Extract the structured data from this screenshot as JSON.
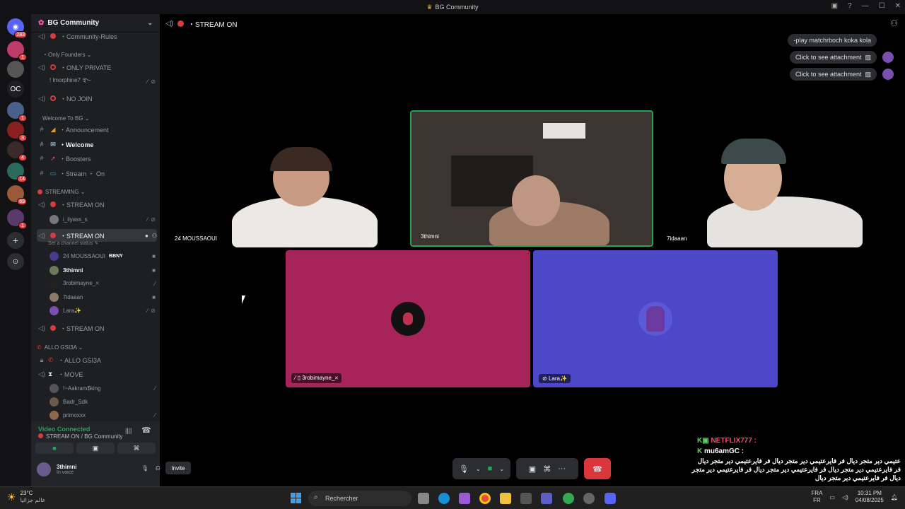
{
  "window": {
    "title": "BG Community",
    "title_icon": "trophy-icon"
  },
  "guilds": {
    "home_badge": "283",
    "items": [
      {
        "label": "",
        "badge": "1"
      },
      {
        "label": "",
        "badge": ""
      },
      {
        "label": "OC",
        "badge": ""
      },
      {
        "label": "",
        "badge": "1"
      },
      {
        "label": "",
        "badge": "3"
      },
      {
        "label": "",
        "badge": "4"
      },
      {
        "label": "",
        "badge": "14"
      },
      {
        "label": "",
        "badge": "69"
      },
      {
        "label": "",
        "badge": "1"
      }
    ]
  },
  "server": {
    "name": "BG Community",
    "channels": [
      {
        "type": "voice",
        "name": "・Community-Rules",
        "icon": "no-entry-icon"
      },
      {
        "type": "category",
        "name": "・Only Founders ⌄"
      },
      {
        "type": "voice",
        "name": "・ONLY PRIVATE",
        "icon": "no-entry-icon"
      },
      {
        "type": "voice",
        "name": "・NO JOIN",
        "icon": "no-entry-icon"
      },
      {
        "type": "category",
        "name": "Welcome To BG ⌄"
      },
      {
        "type": "text",
        "name": "・Announcement",
        "icon": "megaphone-icon"
      },
      {
        "type": "text",
        "name": "・Welcome",
        "icon": "envelope-icon"
      },
      {
        "type": "text",
        "name": "・Boosters",
        "icon": "rocket-icon"
      },
      {
        "type": "text",
        "name": "・Stream ・ On",
        "icon": "monitor-icon"
      },
      {
        "type": "category",
        "name": "STREAMING ⌄"
      },
      {
        "type": "voice",
        "name": "・STREAM ON",
        "icon": "red-circle-icon"
      },
      {
        "type": "voice",
        "name": "・STREAM ON",
        "icon": "red-circle-icon"
      },
      {
        "type": "voice",
        "name": "・STREAM ON",
        "icon": "red-circle-icon"
      },
      {
        "type": "category",
        "name": "ALLO GSI3A ⌄"
      },
      {
        "type": "voice",
        "name": "・ALLO GSI3A",
        "icon": "phone-icon"
      },
      {
        "type": "voice",
        "name": "・MOVE",
        "icon": "hourglass-icon"
      }
    ],
    "channel_status_hint": "Set a channel status ✎",
    "users_private": [
      {
        "name": "! lmorphine7 ࿐"
      }
    ],
    "users_stream1": [
      {
        "name": "i_ilyass_s"
      }
    ],
    "users_stream2": [
      {
        "name": "24 MOUSSAOUI",
        "tag": "BBNY"
      },
      {
        "name": "3thimni"
      },
      {
        "name": "3robimayne_🞪"
      },
      {
        "name": "7idaaan"
      },
      {
        "name": "Lara✨"
      }
    ],
    "users_move": [
      {
        "name": "!~Aakram$king"
      },
      {
        "name": "Badr_Sdk"
      },
      {
        "name": "primoxxx"
      }
    ]
  },
  "voice_panel": {
    "status": "Video Connected",
    "location": "STREAM ON / BG Community",
    "user_name": "3thimni",
    "user_status": "In voice"
  },
  "stage": {
    "channel": "・STREAM ON",
    "tiles": [
      {
        "name": "24 MOUSSAOUI"
      },
      {
        "name": "3thimni"
      },
      {
        "name": "7idaaan"
      },
      {
        "name": "3robimayne_🞪"
      },
      {
        "name": "Lara✨"
      }
    ],
    "chat": [
      {
        "text": "-play matchrboch koka kola"
      },
      {
        "text": "Click to see attachment"
      },
      {
        "text": "Click to see attachment"
      }
    ],
    "invite_label": "Invite",
    "colors": {
      "tile_pink": "#a7245a",
      "tile_blue": "#4c48c9",
      "hangup": "#da373c"
    }
  },
  "overlay": {
    "names": [
      "NETFLIX777 :",
      "mu6amGC :"
    ],
    "text": "عتيمي دير متجر ديال فر فايرعتيمي دير متجر ديال فر فايرعتيمي دير متجر ديال فر فايرعتيمي دير متجر ديال فر فايرعتيمي دير متجر ديال فر فايرعتيمي دير متجر ديال فر فايرعتيمي دير متجر ديال"
  },
  "taskbar": {
    "weather_temp": "23°C",
    "weather_text": "عالم جزائيا",
    "search_placeholder": "Rechercher",
    "lang_top": "FRA",
    "lang_bottom": "FR",
    "time": "10:31 PM",
    "date": "04/08/2025"
  }
}
